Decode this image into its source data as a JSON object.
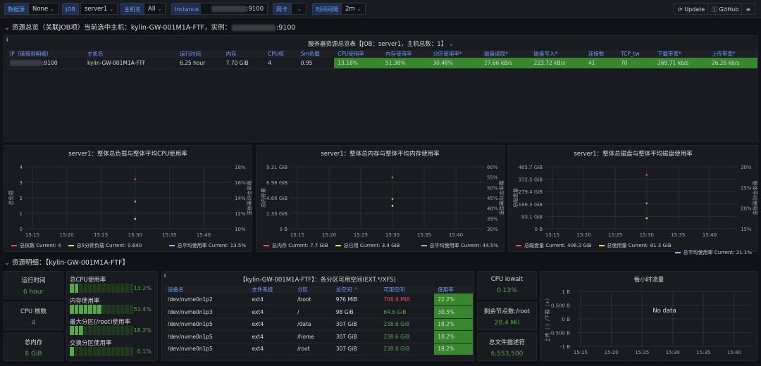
{
  "topbar": {
    "datasource_label": "数据源",
    "datasource_value": "None",
    "job_label": "JOB",
    "job_value": "server1",
    "host_label": "主机名",
    "host_value": "All",
    "instance_label": "Instance",
    "instance_value": ":9100",
    "nic_label": "网卡",
    "interval_label": "时间间隔",
    "interval_value": "2m",
    "update_label": "Update",
    "github_label": "GitHub"
  },
  "row1": {
    "title": "资源总览（关联JOB项）当前选中主机：kylin-GW-001M1A-FTF，实例：",
    "instance": ":9100"
  },
  "summary": {
    "title": "服务器资源总览表【JOB：server1，主机总数：1】",
    "headers": [
      "IP（链接到明细）",
      "主机名",
      "运行时间",
      "内存",
      "CPU核",
      "5m负载",
      "CPU使用率",
      "内存使用率",
      "分区使用率*",
      "磁盘读取*",
      "磁盘写入*",
      "连接数",
      "TCP_tw",
      "下载带宽*",
      "上传带宽*"
    ],
    "row": [
      ":9100",
      "kylin-GW-001M1A-FTF",
      "6.25 hour",
      "7.70 GiB",
      "4",
      "0.95",
      "13.18%",
      "51.38%",
      "30.48%",
      "27.66 kB/s",
      "223.72 kB/s",
      "41",
      "70",
      "269.71 kb/s",
      "26.26 kb/s"
    ]
  },
  "charts": [
    {
      "title": "server1：整体总负载与整体平均CPU使用率",
      "left_label": "总负载",
      "right_label": "整体平均使用率",
      "yleft": [
        "4",
        "3",
        "2",
        "1",
        "0"
      ],
      "yright": [
        "18%",
        "16%",
        "14%",
        "12%",
        "10%"
      ],
      "x": [
        "15:15",
        "15:20",
        "15:25",
        "15:30",
        "15:35",
        "15:40"
      ],
      "legend": [
        {
          "name": "总核数",
          "current": "Current: 4",
          "color": "#f2495c"
        },
        {
          "name": "总5分钟负载",
          "current": "Current: 0.640",
          "color": "#fade2a"
        },
        {
          "name": "总平均使用率",
          "current": "Current: 13.5%",
          "color": "#8ab8ff"
        }
      ]
    },
    {
      "title": "server1：整体总内存与整体平均内存使用率",
      "left_label": "总内存量",
      "right_label": "整体平均使用率",
      "yleft": [
        "9.31 GiB",
        "6.98 GiB",
        "4.66 GiB",
        "2.33 GiB",
        "0 B"
      ],
      "yright": [
        "60%",
        "55%",
        "50%",
        "45%",
        "40%",
        "35%",
        "30%"
      ],
      "x": [
        "15:15",
        "15:20",
        "15:25",
        "15:30",
        "15:35",
        "15:40"
      ],
      "legend": [
        {
          "name": "总内存",
          "current": "Current: 7.7 GiB",
          "color": "#f2495c"
        },
        {
          "name": "总已用",
          "current": "Current: 3.4 GiB",
          "color": "#fade2a"
        },
        {
          "name": "总平均使用率",
          "current": "Current: 44.5%",
          "color": "#8ab8ff"
        }
      ]
    },
    {
      "title": "server1：整体总磁盘与整体平均磁盘使用率",
      "left_label": "总磁盘量",
      "right_label": "整体平均使用率",
      "yleft": [
        "465.7 GiB",
        "372.5 GiB",
        "279.4 GiB",
        "186.3 GiB",
        "93.1 GiB",
        "0 B"
      ],
      "yright": [
        "30%",
        "25%",
        "20%",
        "15%"
      ],
      "x": [
        "15:15",
        "15:20",
        "15:25",
        "15:30",
        "15:35",
        "15:40"
      ],
      "legend": [
        {
          "name": "总磁盘量",
          "current": "Current: 406.2 GiB",
          "color": "#f2495c"
        },
        {
          "name": "总使用量",
          "current": "Current: 81.3 GiB",
          "color": "#fade2a"
        },
        {
          "name": "总平均使用率",
          "current": "Current: 21.1%",
          "color": "#8ab8ff"
        }
      ]
    }
  ],
  "row2": {
    "title": "资源明细：【kylin-GW-001M1A-FTF】"
  },
  "stats": {
    "uptime_label": "运行时间",
    "uptime_value": "6 hour",
    "cpu_label": "CPU 核数",
    "cpu_value": "4",
    "mem_label": "总内存",
    "mem_value": "8 GiB",
    "iowait_label": "CPU iowait",
    "iowait_value": "0.13%",
    "root_label": "剩余节点数:/root",
    "root_value": "20.4 Mil",
    "fd_label": "总文件描述符",
    "fd_value": "6,553,500"
  },
  "gauges": [
    {
      "label": "总CPU使用率",
      "value": "13.2%",
      "level": 0.132
    },
    {
      "label": "内存使用率",
      "value": "51.4%",
      "level": 0.514
    },
    {
      "label": "最大分区(/root)使用率",
      "value": "18.2%",
      "level": 0.182
    },
    {
      "label": "交换分区使用率",
      "value": "0.1%",
      "level": 0.001
    }
  ],
  "partitions": {
    "title": "【kylin-GW-001M1A-FTF】：各分区可用空间(EXT.*/XFS)",
    "headers": [
      "设备名",
      "文件系统",
      "分区",
      "总空间",
      "可用空间",
      "使用率"
    ],
    "rows": [
      [
        "/dev/nvme0n1p2",
        "ext4",
        "/boot",
        "976 MiB",
        "706.9 MiB",
        "22.2%"
      ],
      [
        "/dev/nvme0n1p3",
        "ext4",
        "/",
        "98 GiB",
        "64.6 GiB",
        "30.5%"
      ],
      [
        "/dev/nvme0n1p5",
        "ext4",
        "/data",
        "307 GiB",
        "238.6 GiB",
        "18.2%"
      ],
      [
        "/dev/nvme0n1p5",
        "ext4",
        "/home",
        "307 GiB",
        "238.6 GiB",
        "18.2%"
      ],
      [
        "/dev/nvme0n1p5",
        "ext4",
        "/root",
        "307 GiB",
        "238.6 GiB",
        "18.2%"
      ]
    ]
  },
  "traffic": {
    "title": "每小时流量",
    "nodata": "No data",
    "ylabel": "上传（-）/下载（+）",
    "y": [
      "1 B",
      "0.500 B",
      "0 B",
      "-0.500 B",
      "-1 B"
    ],
    "x": [
      "15:15",
      "15:20",
      "15:25",
      "15:30",
      "15:35",
      "15:40"
    ]
  }
}
